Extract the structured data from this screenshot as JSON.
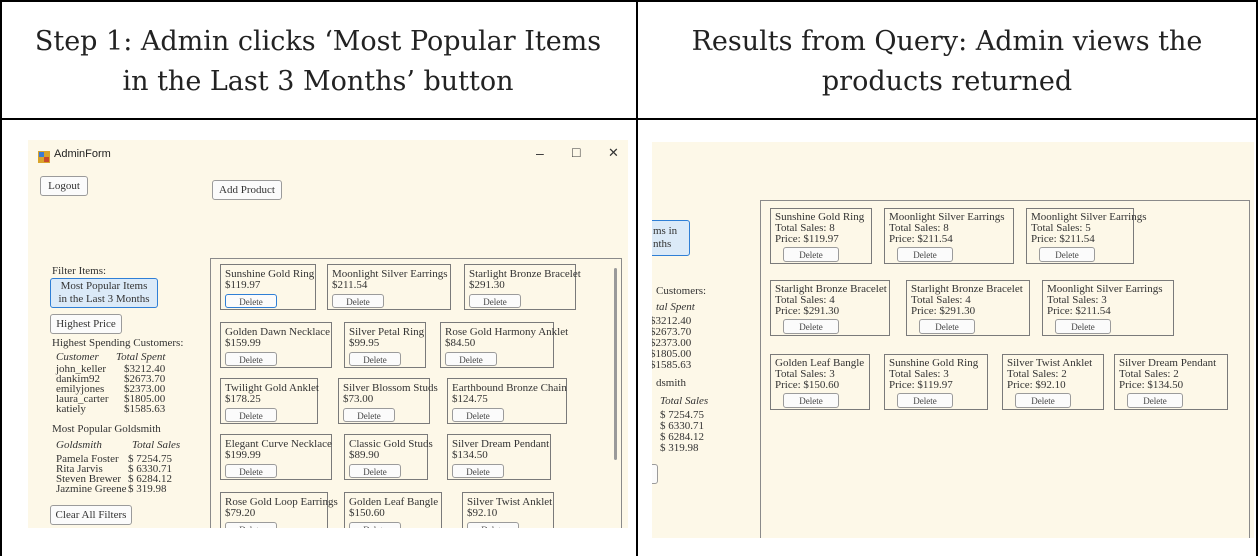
{
  "headers": {
    "left": "Step 1: Admin clicks ‘Most Popular Items in the Last 3 Months’ button",
    "right": "Results from Query: Admin views the products returned"
  },
  "window": {
    "title": "AdminForm",
    "minimize": "–",
    "maximize": "□",
    "close": "✕"
  },
  "left": {
    "logout": "Logout",
    "add_product": "Add Product",
    "filter_label": "Filter Items:",
    "most_popular_btn": "Most Popular Items in the Last 3 Months",
    "highest_price_btn": "Highest Price",
    "customers_title": "Highest Spending Customers:",
    "customers_header": {
      "name": "Customer",
      "value": "Total Spent"
    },
    "customers": [
      {
        "name": "john_keller",
        "value": "$3212.40"
      },
      {
        "name": "dankim92",
        "value": "$2673.70"
      },
      {
        "name": "emilyjones",
        "value": "$2373.00"
      },
      {
        "name": "laura_carter",
        "value": "$1805.00"
      },
      {
        "name": "katiely",
        "value": "$1585.63"
      }
    ],
    "goldsmith_title": "Most Popular Goldsmith",
    "goldsmith_header": {
      "name": "Goldsmith",
      "value": "Total Sales"
    },
    "goldsmiths": [
      {
        "name": "Pamela Foster",
        "value": "$ 7254.75"
      },
      {
        "name": "Rita Jarvis",
        "value": "$ 6330.71"
      },
      {
        "name": "Steven Brewer",
        "value": "$ 6284.12"
      },
      {
        "name": "Jazmine Greene",
        "value": "$ 319.98"
      }
    ],
    "clear_btn": "Clear All Filters",
    "delete_label": "Delete",
    "products": [
      {
        "name": "Sunshine Gold Ring",
        "price": "$119.97"
      },
      {
        "name": "Moonlight Silver Earrings",
        "price": "$211.54"
      },
      {
        "name": "Starlight Bronze Bracelet",
        "price": "$291.30"
      },
      {
        "name": "Golden Dawn Necklace",
        "price": "$159.99"
      },
      {
        "name": "Silver Petal Ring",
        "price": "$99.95"
      },
      {
        "name": "Rose Gold Harmony Anklet",
        "price": "$84.50"
      },
      {
        "name": "Twilight Gold Anklet",
        "price": "$178.25"
      },
      {
        "name": "Silver Blossom Studs",
        "price": "$73.00"
      },
      {
        "name": "Earthbound Bronze Chain",
        "price": "$124.75"
      },
      {
        "name": "Elegant Curve Necklace",
        "price": "$199.99"
      },
      {
        "name": "Classic Gold Studs",
        "price": "$89.90"
      },
      {
        "name": "Silver Dream Pendant",
        "price": "$134.50"
      },
      {
        "name": "Rose Gold Loop Earrings",
        "price": "$79.20"
      },
      {
        "name": "Golden Leaf Bangle",
        "price": "$150.60"
      },
      {
        "name": "Silver Twist Anklet",
        "price": "$92.10"
      }
    ]
  },
  "right": {
    "partial_btn_line1": "ms in",
    "partial_btn_line2": "nths",
    "partial_customers": "Customers:",
    "partial_spent_header": "tal Spent",
    "partial_spent": [
      "$3212.40",
      "$2673.70",
      "$2373.00",
      "$1805.00",
      "$1585.63"
    ],
    "partial_goldsmith": "dsmith",
    "partial_sales_header": "Total Sales",
    "partial_sales": [
      "$ 7254.75",
      "$ 6330.71",
      "$ 6284.12",
      "$ 319.98"
    ],
    "delete_label": "Delete",
    "results": [
      {
        "name": "Sunshine Gold Ring",
        "sales": "Total Sales: 8",
        "price": "Price: $119.97"
      },
      {
        "name": "Moonlight Silver Earrings",
        "sales": "Total Sales: 8",
        "price": "Price: $211.54"
      },
      {
        "name": "Moonlight Silver Earrings",
        "sales": "Total Sales: 5",
        "price": "Price: $211.54"
      },
      {
        "name": "Starlight Bronze Bracelet",
        "sales": "Total Sales: 4",
        "price": "Price: $291.30"
      },
      {
        "name": "Starlight Bronze Bracelet",
        "sales": "Total Sales: 4",
        "price": "Price: $291.30"
      },
      {
        "name": "Moonlight Silver Earrings",
        "sales": "Total Sales: 3",
        "price": "Price: $211.54"
      },
      {
        "name": "Golden Leaf Bangle",
        "sales": "Total Sales: 3",
        "price": "Price: $150.60"
      },
      {
        "name": "Sunshine Gold Ring",
        "sales": "Total Sales: 3",
        "price": "Price: $119.97"
      },
      {
        "name": "Silver Twist Anklet",
        "sales": "Total Sales: 2",
        "price": "Price: $92.10"
      },
      {
        "name": "Silver Dream Pendant",
        "sales": "Total Sales: 2",
        "price": "Price: $134.50"
      }
    ]
  }
}
